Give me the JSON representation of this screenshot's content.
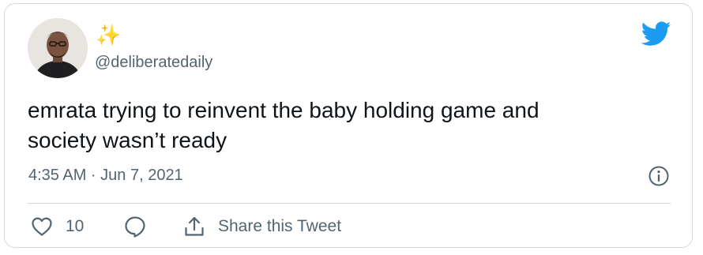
{
  "tweet": {
    "display_name": "✨",
    "handle": "@deliberatedaily",
    "text_line1": "emrata trying to reinvent the baby holding game and",
    "text_line2": "society wasn’t ready",
    "timestamp": "4:35 AM · Jun 7, 2021"
  },
  "actions": {
    "like_count": "10",
    "share_label": "Share this Tweet"
  },
  "icons": {
    "brand": "twitter-bird-icon",
    "like": "heart-icon",
    "reply": "speech-bubble-icon",
    "share": "share-upload-icon",
    "info": "info-icon"
  },
  "colors": {
    "brand_blue": "#1d9bf0",
    "text_primary": "#0f1419",
    "text_secondary": "#536471",
    "border": "#cfd9de"
  }
}
